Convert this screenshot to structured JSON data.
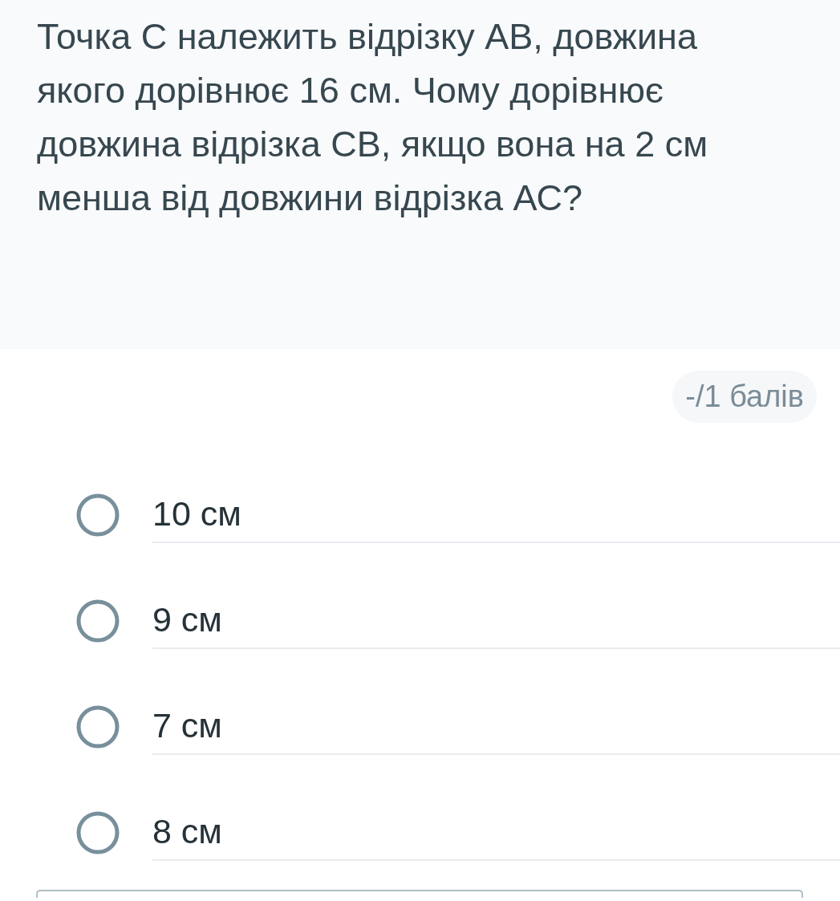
{
  "question": {
    "text": "Точка С належить відрізку АВ, довжина якого дорівнює 16 см. Чому дорівнює довжина відрізка СВ, якщо вона на 2 см менша від довжини відрізка АС?"
  },
  "points": {
    "text": "-/1 балів"
  },
  "options": [
    {
      "label": "10 см",
      "selected": false
    },
    {
      "label": "9 см",
      "selected": false
    },
    {
      "label": "7 см",
      "selected": false
    },
    {
      "label": "8 см",
      "selected": false
    }
  ]
}
